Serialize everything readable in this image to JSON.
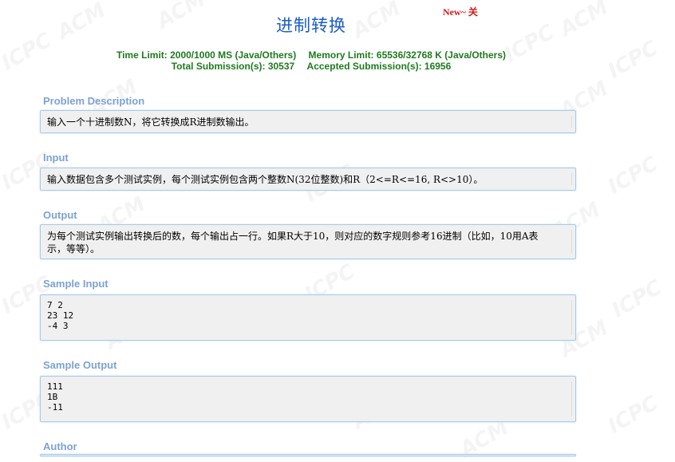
{
  "problem": {
    "title": "进制转换",
    "new_badge": "New~ 关",
    "time_limit": "Time Limit: 2000/1000 MS (Java/Others)",
    "memory_limit": "Memory Limit: 65536/32768 K (Java/Others)",
    "total_submissions": "Total Submission(s): 30537",
    "accepted_submissions": "Accepted Submission(s): 16956"
  },
  "sections": {
    "description_title": "Problem Description",
    "description_text": "输入一个十进制数N，将它转换成R进制数输出。",
    "input_title": "Input",
    "input_text": "输入数据包含多个测试实例，每个测试实例包含两个整数N(32位整数)和R（2<=R<=16, R<>10）。",
    "output_title": "Output",
    "output_text": "为每个测试实例输出转换后的数，每个输出占一行。如果R大于10，则对应的数字规则参考16进制（比如，10用A表示，等等）。",
    "sample_input_title": "Sample Input",
    "sample_input_lines": [
      "7 2",
      "23 12",
      "-4 3"
    ],
    "sample_output_title": "Sample Output",
    "sample_output_lines": [
      "111",
      "1B",
      "-11"
    ],
    "author_title": "Author"
  },
  "watermark": {
    "words": [
      "ACM",
      "ICPC"
    ]
  },
  "colors": {
    "title": "#1a5cc8",
    "stats": "#1f7a1f",
    "section_title": "#7da2d6",
    "panel_border": "#a5cbe9",
    "panel_bg": "#f0f0f0",
    "badge": "#d21a1a"
  }
}
